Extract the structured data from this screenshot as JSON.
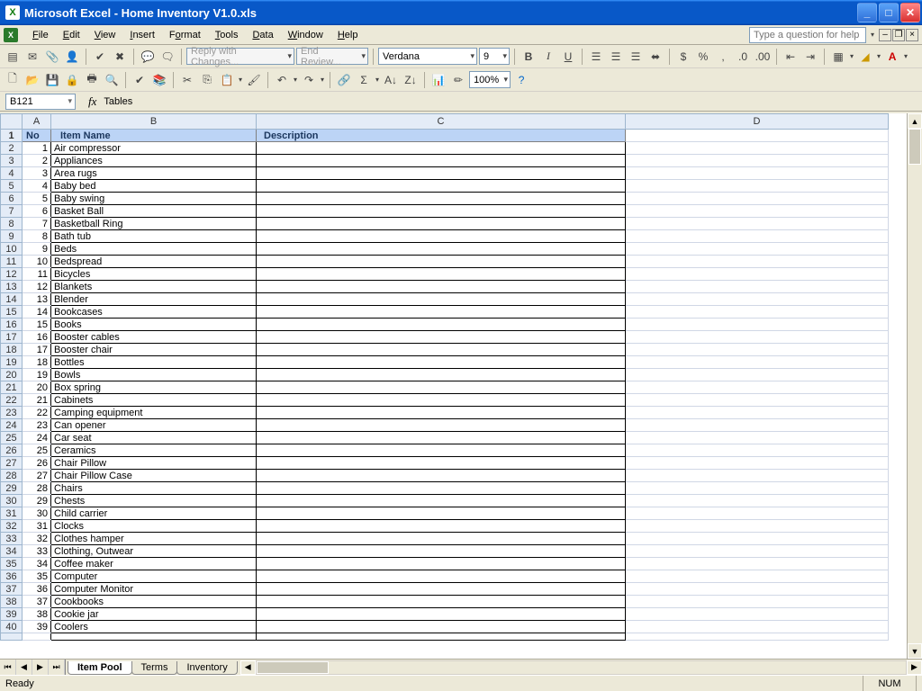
{
  "titlebar": {
    "app": "Microsoft Excel",
    "doc": "Home Inventory V1.0.xls"
  },
  "menu": {
    "file": "File",
    "edit": "Edit",
    "view": "View",
    "insert": "Insert",
    "format": "Format",
    "tools": "Tools",
    "data": "Data",
    "window": "Window",
    "help": "Help",
    "help_placeholder": "Type a question for help"
  },
  "toolbar1": {
    "reply": "Reply with Changes...",
    "endreview": "End Review...",
    "font": "Verdana",
    "size": "9"
  },
  "toolbar2": {
    "zoom": "100%"
  },
  "formula": {
    "cell": "B121",
    "value": "Tables"
  },
  "columns": {
    "A": "A",
    "B": "B",
    "C": "C",
    "D": "D"
  },
  "headers": {
    "no": "No",
    "item": "Item Name",
    "desc": "Description"
  },
  "rows": [
    {
      "n": 1,
      "name": "Air compressor"
    },
    {
      "n": 2,
      "name": "Appliances"
    },
    {
      "n": 3,
      "name": "Area rugs"
    },
    {
      "n": 4,
      "name": "Baby bed"
    },
    {
      "n": 5,
      "name": "Baby swing"
    },
    {
      "n": 6,
      "name": "Basket Ball"
    },
    {
      "n": 7,
      "name": "Basketball Ring"
    },
    {
      "n": 8,
      "name": "Bath tub"
    },
    {
      "n": 9,
      "name": "Beds"
    },
    {
      "n": 10,
      "name": "Bedspread"
    },
    {
      "n": 11,
      "name": "Bicycles"
    },
    {
      "n": 12,
      "name": "Blankets"
    },
    {
      "n": 13,
      "name": "Blender"
    },
    {
      "n": 14,
      "name": "Bookcases"
    },
    {
      "n": 15,
      "name": "Books"
    },
    {
      "n": 16,
      "name": "Booster cables"
    },
    {
      "n": 17,
      "name": "Booster chair"
    },
    {
      "n": 18,
      "name": "Bottles"
    },
    {
      "n": 19,
      "name": "Bowls"
    },
    {
      "n": 20,
      "name": "Box spring"
    },
    {
      "n": 21,
      "name": "Cabinets"
    },
    {
      "n": 22,
      "name": "Camping equipment"
    },
    {
      "n": 23,
      "name": "Can opener"
    },
    {
      "n": 24,
      "name": "Car seat"
    },
    {
      "n": 25,
      "name": "Ceramics"
    },
    {
      "n": 26,
      "name": "Chair Pillow"
    },
    {
      "n": 27,
      "name": "Chair Pillow Case"
    },
    {
      "n": 28,
      "name": "Chairs"
    },
    {
      "n": 29,
      "name": "Chests"
    },
    {
      "n": 30,
      "name": "Child carrier"
    },
    {
      "n": 31,
      "name": "Clocks"
    },
    {
      "n": 32,
      "name": "Clothes hamper"
    },
    {
      "n": 33,
      "name": "Clothing, Outwear"
    },
    {
      "n": 34,
      "name": "Coffee maker"
    },
    {
      "n": 35,
      "name": "Computer"
    },
    {
      "n": 36,
      "name": "Computer Monitor"
    },
    {
      "n": 37,
      "name": "Cookbooks"
    },
    {
      "n": 38,
      "name": "Cookie jar"
    },
    {
      "n": 39,
      "name": "Coolers"
    }
  ],
  "last_partial_row": 40,
  "tabs": {
    "t1": "Item Pool",
    "t2": "Terms",
    "t3": "Inventory"
  },
  "status": {
    "ready": "Ready",
    "num": "NUM"
  }
}
